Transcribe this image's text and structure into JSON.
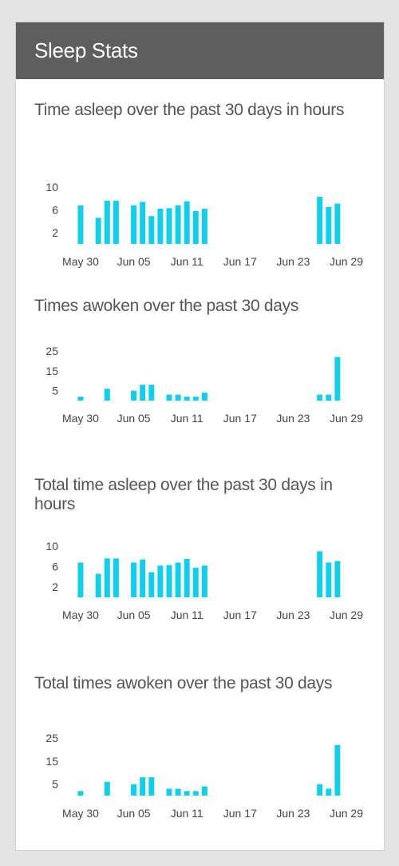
{
  "panel": {
    "title": "Sleep Stats"
  },
  "colors": {
    "bar": "#10cfee",
    "header_bg": "#5e5e5e",
    "header_text": "#ffffff",
    "title_text": "#555555"
  },
  "chart_data": [
    {
      "type": "bar",
      "title": "Time asleep over the past 30 days in hours",
      "x_tick_labels": [
        "May 30",
        "Jun 05",
        "Jun 11",
        "Jun 17",
        "Jun 23",
        "Jun 29"
      ],
      "y_tick_labels": [
        "10",
        "6",
        "2"
      ],
      "yticks": [
        10,
        6,
        2
      ],
      "ylim": [
        0,
        10
      ],
      "categories": [
        "May 30",
        "May 31",
        "Jun 01",
        "Jun 02",
        "Jun 03",
        "Jun 04",
        "Jun 05",
        "Jun 06",
        "Jun 07",
        "Jun 08",
        "Jun 09",
        "Jun 10",
        "Jun 11",
        "Jun 12",
        "Jun 13",
        "Jun 14",
        "Jun 15",
        "Jun 16",
        "Jun 17",
        "Jun 18",
        "Jun 19",
        "Jun 20",
        "Jun 21",
        "Jun 22",
        "Jun 23",
        "Jun 24",
        "Jun 25",
        "Jun 26",
        "Jun 27",
        "Jun 28",
        "Jun 29"
      ],
      "values": [
        6.8,
        0,
        4.6,
        7.6,
        7.6,
        0,
        6.8,
        7.4,
        4.9,
        6.2,
        6.3,
        6.8,
        7.5,
        5.8,
        6.2,
        0,
        0,
        0,
        0,
        0,
        0,
        0,
        0,
        0,
        0,
        0,
        0,
        8.3,
        6.5,
        7.1,
        0
      ],
      "legend": false,
      "grid": false
    },
    {
      "type": "bar",
      "title": "Times awoken over the past 30 days",
      "x_tick_labels": [
        "May 30",
        "Jun 05",
        "Jun 11",
        "Jun 17",
        "Jun 23",
        "Jun 29"
      ],
      "y_tick_labels": [
        "25",
        "15",
        "5"
      ],
      "yticks": [
        25,
        15,
        5
      ],
      "ylim": [
        0,
        25
      ],
      "categories": [
        "May 30",
        "May 31",
        "Jun 01",
        "Jun 02",
        "Jun 03",
        "Jun 04",
        "Jun 05",
        "Jun 06",
        "Jun 07",
        "Jun 08",
        "Jun 09",
        "Jun 10",
        "Jun 11",
        "Jun 12",
        "Jun 13",
        "Jun 14",
        "Jun 15",
        "Jun 16",
        "Jun 17",
        "Jun 18",
        "Jun 19",
        "Jun 20",
        "Jun 21",
        "Jun 22",
        "Jun 23",
        "Jun 24",
        "Jun 25",
        "Jun 26",
        "Jun 27",
        "Jun 28",
        "Jun 29"
      ],
      "values": [
        2,
        0,
        0,
        6,
        0,
        0,
        5,
        8,
        8,
        0,
        3,
        3,
        2,
        2,
        4,
        0,
        0,
        0,
        0,
        0,
        0,
        0,
        0,
        0,
        0,
        0,
        0,
        3,
        3,
        22,
        0
      ],
      "legend": false,
      "grid": false
    },
    {
      "type": "bar",
      "title": "Total time asleep over the past 30 days in hours",
      "x_tick_labels": [
        "May 30",
        "Jun 05",
        "Jun 11",
        "Jun 17",
        "Jun 23",
        "Jun 29"
      ],
      "y_tick_labels": [
        "10",
        "6",
        "2"
      ],
      "yticks": [
        10,
        6,
        2
      ],
      "ylim": [
        0,
        10
      ],
      "categories": [
        "May 30",
        "May 31",
        "Jun 01",
        "Jun 02",
        "Jun 03",
        "Jun 04",
        "Jun 05",
        "Jun 06",
        "Jun 07",
        "Jun 08",
        "Jun 09",
        "Jun 10",
        "Jun 11",
        "Jun 12",
        "Jun 13",
        "Jun 14",
        "Jun 15",
        "Jun 16",
        "Jun 17",
        "Jun 18",
        "Jun 19",
        "Jun 20",
        "Jun 21",
        "Jun 22",
        "Jun 23",
        "Jun 24",
        "Jun 25",
        "Jun 26",
        "Jun 27",
        "Jun 28",
        "Jun 29"
      ],
      "values": [
        6.8,
        0,
        4.6,
        7.6,
        7.6,
        0,
        6.8,
        7.4,
        4.9,
        6.2,
        6.3,
        6.8,
        7.5,
        5.8,
        6.2,
        0,
        0,
        0,
        0,
        0,
        0,
        0,
        0,
        0,
        0,
        0,
        0,
        9.0,
        6.8,
        7.1,
        0
      ],
      "legend": false,
      "grid": false
    },
    {
      "type": "bar",
      "title": "Total times awoken over the past 30 days",
      "x_tick_labels": [
        "May 30",
        "Jun 05",
        "Jun 11",
        "Jun 17",
        "Jun 23",
        "Jun 29"
      ],
      "y_tick_labels": [
        "25",
        "15",
        "5"
      ],
      "yticks": [
        25,
        15,
        5
      ],
      "ylim": [
        0,
        25
      ],
      "categories": [
        "May 30",
        "May 31",
        "Jun 01",
        "Jun 02",
        "Jun 03",
        "Jun 04",
        "Jun 05",
        "Jun 06",
        "Jun 07",
        "Jun 08",
        "Jun 09",
        "Jun 10",
        "Jun 11",
        "Jun 12",
        "Jun 13",
        "Jun 14",
        "Jun 15",
        "Jun 16",
        "Jun 17",
        "Jun 18",
        "Jun 19",
        "Jun 20",
        "Jun 21",
        "Jun 22",
        "Jun 23",
        "Jun 24",
        "Jun 25",
        "Jun 26",
        "Jun 27",
        "Jun 28",
        "Jun 29"
      ],
      "values": [
        2,
        0,
        0,
        6,
        0,
        0,
        5,
        8,
        8,
        0,
        3,
        3,
        2,
        2,
        4,
        0,
        0,
        0,
        0,
        0,
        0,
        0,
        0,
        0,
        0,
        0,
        0,
        5,
        3,
        22,
        0
      ],
      "legend": false,
      "grid": false
    }
  ]
}
